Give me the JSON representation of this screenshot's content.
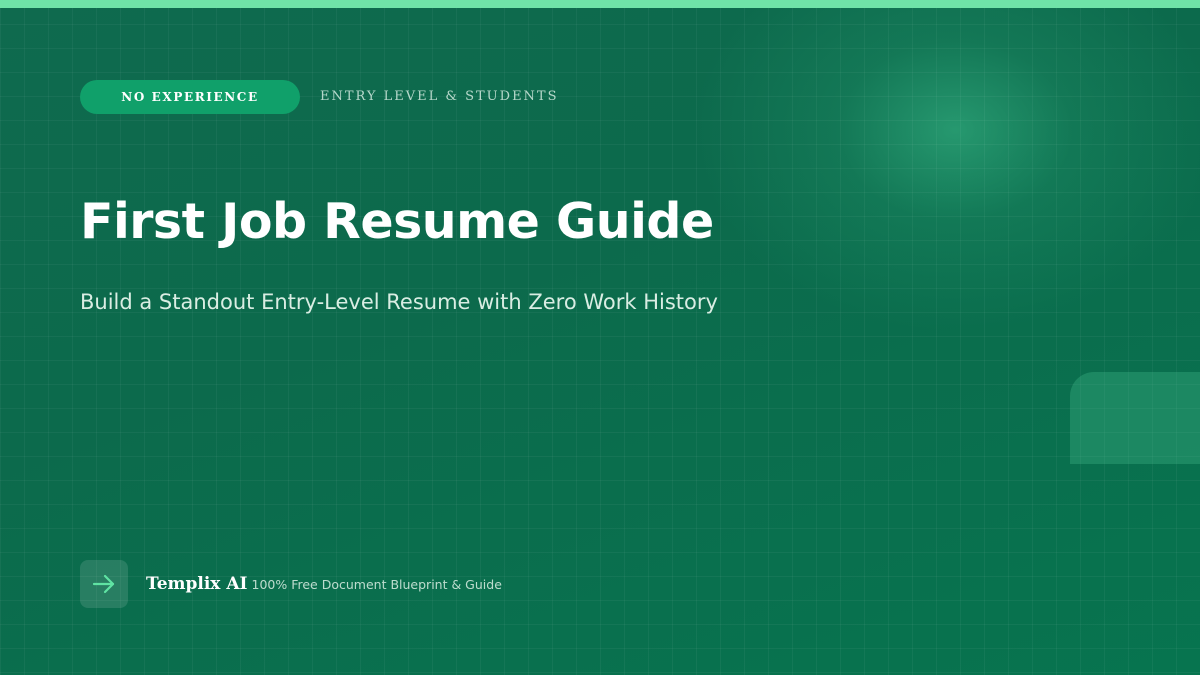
{
  "colors": {
    "top_bar": "#6fe3a8",
    "badge_bg": "#10a06a",
    "arrow": "#5fe3a3"
  },
  "header": {
    "badge_label": "NO EXPERIENCE",
    "audience_label": "ENTRY LEVEL & STUDENTS"
  },
  "hero": {
    "title": "First Job Resume Guide",
    "subtitle": "Build a Standout Entry-Level Resume with Zero Work History"
  },
  "footer": {
    "logo_icon": "arrow-right-icon",
    "brand": "Templix AI",
    "tagline": "100% Free Document Blueprint & Guide"
  }
}
